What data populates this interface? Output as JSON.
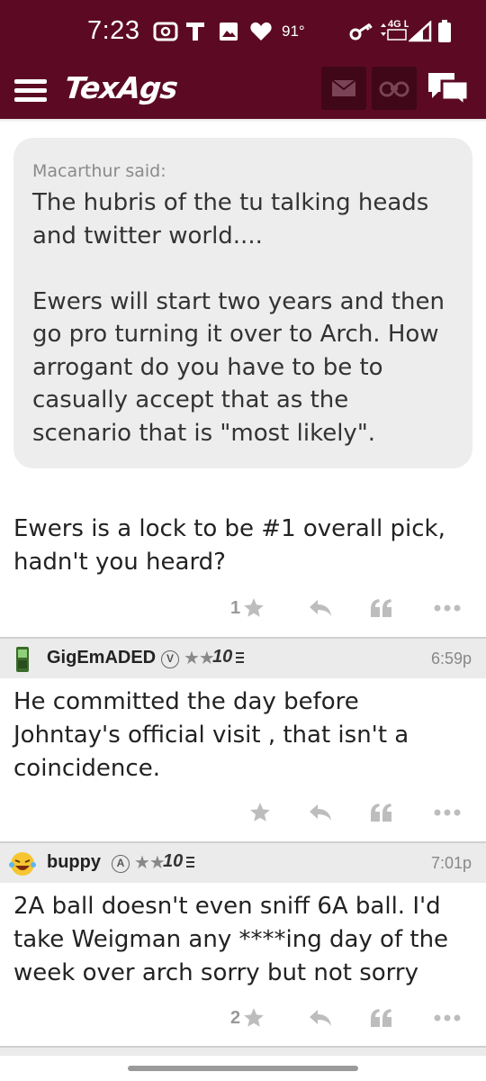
{
  "status_bar": {
    "time": "7:23",
    "temperature": "91°",
    "network": "4G LTE",
    "icons": [
      "radio-icon",
      "t-icon",
      "image-icon",
      "heart-icon",
      "key-icon",
      "data-arrows-icon",
      "signal-icon",
      "battery-icon"
    ]
  },
  "app_bar": {
    "logo": "TexAgs",
    "buttons": [
      "menu-icon",
      "mail-icon",
      "binoculars-icon",
      "chat-icon"
    ],
    "bar_color": "#5c0a24"
  },
  "posts": [
    {
      "quote": {
        "author": "Macarthur said:",
        "text": "The hubris of the tu talking heads and twitter world....\n\nEwers will start two years and then go pro turning it over to Arch. How arrogant do you have to be to casually accept that as the scenario that is \"most likely\"."
      },
      "body": "Ewers is a lock to be #1 overall pick, hadn't you heard?",
      "star_count": "1"
    },
    {
      "username": "GigEmADED",
      "badge": "V",
      "stars": "★★",
      "rank": "10",
      "time": "6:59p",
      "avatar": "phone-icon",
      "body": "He committed the day before Johntay's official visit , that isn't a coincidence.",
      "star_count": ""
    },
    {
      "username": "buppy",
      "badge": "A",
      "stars": "★★",
      "rank": "10",
      "time": "7:01p",
      "avatar": "laughing-emoji-icon",
      "body": "2A ball doesn't even sniff 6A ball. I'd take Weigman any ****ing day of the week over arch sorry but not sorry",
      "star_count": "2"
    }
  ]
}
